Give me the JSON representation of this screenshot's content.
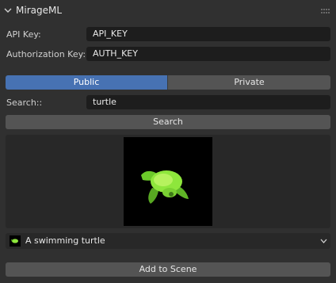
{
  "panel": {
    "title": "MirageML"
  },
  "fields": {
    "api_key_label": "API Key:",
    "api_key_value": "API_KEY",
    "auth_key_label": "Authorization Key:",
    "auth_key_value": "AUTH_KEY"
  },
  "visibility": {
    "public_label": "Public",
    "private_label": "Private",
    "selected": "Public"
  },
  "search": {
    "label": "Search::",
    "value": "turtle",
    "button_label": "Search"
  },
  "result": {
    "preview_icon": "turtle-preview-image",
    "selected_model": "A swimming turtle"
  },
  "actions": {
    "add_label": "Add to Scene"
  },
  "colors": {
    "accent": "#4772b3",
    "panel_bg": "#303030",
    "field_bg": "#1d1d1d",
    "button_bg": "#545454",
    "turtle_green": "#8ee63c"
  }
}
